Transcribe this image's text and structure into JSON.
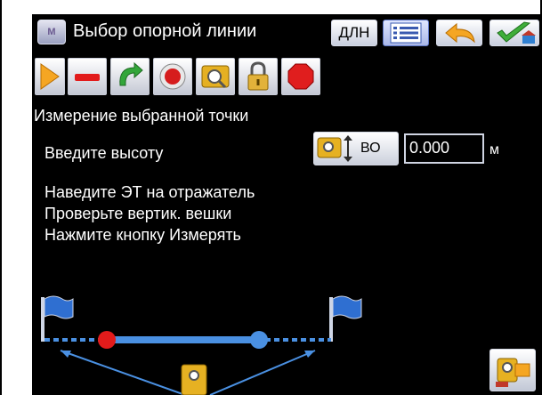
{
  "header": {
    "menu_label": "M",
    "title": "Выбор опорной линии",
    "dln_label": "ДЛН",
    "icons": [
      "list-icon",
      "undo-arrow-icon",
      "accept-check-icon"
    ]
  },
  "toolbar": {
    "tools": [
      "play-triangle-icon",
      "stop-record-icon",
      "rotate-arrow-icon",
      "record-circle-icon",
      "total-station-search-icon",
      "lock-icon",
      "red-hexagon-icon"
    ]
  },
  "main": {
    "section_title": "Измерение выбранной точки",
    "height_label": "Введите высоту",
    "height_button_label": "ВО",
    "height_value": "0.000",
    "height_unit": "м",
    "instructions": [
      "Наведите ЭТ на отражатель",
      "Проверьте вертик. вешки",
      "Нажмите кнопку Измерять"
    ]
  },
  "colors": {
    "background": "#000000",
    "text": "#ffffff",
    "accent_orange": "#f5a623",
    "accent_red": "#e21b1b",
    "line_blue": "#4a90e2"
  }
}
